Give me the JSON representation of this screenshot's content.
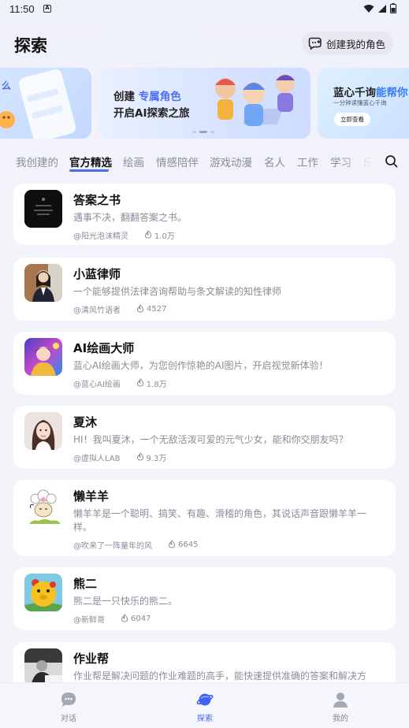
{
  "status_bar": {
    "time": "11:50"
  },
  "header": {
    "title": "探索",
    "create_button": "创建我的角色"
  },
  "banners": {
    "left": {
      "partial_text": "么"
    },
    "middle": {
      "line1_prefix": "创建 ",
      "line1_highlight": "专属角色",
      "line2": "开启AI探索之旅"
    },
    "right": {
      "title_prefix": "蓝心千询",
      "title_highlight": "能帮你",
      "subtitle": "一分钟读懂蓝心千询",
      "button": "立即查看"
    }
  },
  "tabs": [
    "我创建的",
    "官方精选",
    "绘画",
    "情感陪伴",
    "游戏动漫",
    "名人",
    "工作",
    "学习",
    "乐趣"
  ],
  "active_tab": "官方精选",
  "cards": [
    {
      "title": "答案之书",
      "desc": "遇事不决，翻翻答案之书。",
      "author": "@阳光泡沫精灵",
      "heat": "1.0万"
    },
    {
      "title": "小蓝律师",
      "desc": "一个能够提供法律咨询帮助与条文解读的知性律师",
      "author": "@清风竹语者",
      "heat": "4527"
    },
    {
      "title": "AI绘画大师",
      "desc": "蓝心AI绘画大师，为您创作惊艳的AI图片，开启视觉新体验！",
      "author": "@蓝心AI绘画",
      "heat": "1.8万"
    },
    {
      "title": "夏沐",
      "desc": "HI！我叫夏沐，一个无敌活泼可爱的元气少女，能和你交朋友吗？",
      "author": "@虚拟人LAB",
      "heat": "9.3万"
    },
    {
      "title": "懒羊羊",
      "desc": "懒羊羊是一个聪明、搞笑、有趣、滑稽的角色，其说话声音跟懒羊羊一样。",
      "author": "@吹来了一阵童年的风",
      "heat": "6645"
    },
    {
      "title": "熊二",
      "desc": "熊二是一只快乐的熊二。",
      "author": "@新鲜哥",
      "heat": "6047"
    },
    {
      "title": "作业帮",
      "desc": "作业帮是解决问题的作业难题的高手，能快速提供准确的答案和解决方",
      "author": "",
      "heat": ""
    }
  ],
  "bottom_nav": {
    "chat": "对话",
    "explore": "探索",
    "me": "我的"
  },
  "colors": {
    "accent": "#3d63f0",
    "muted_text": "#8a8d9a",
    "card_bg": "#ffffff"
  }
}
